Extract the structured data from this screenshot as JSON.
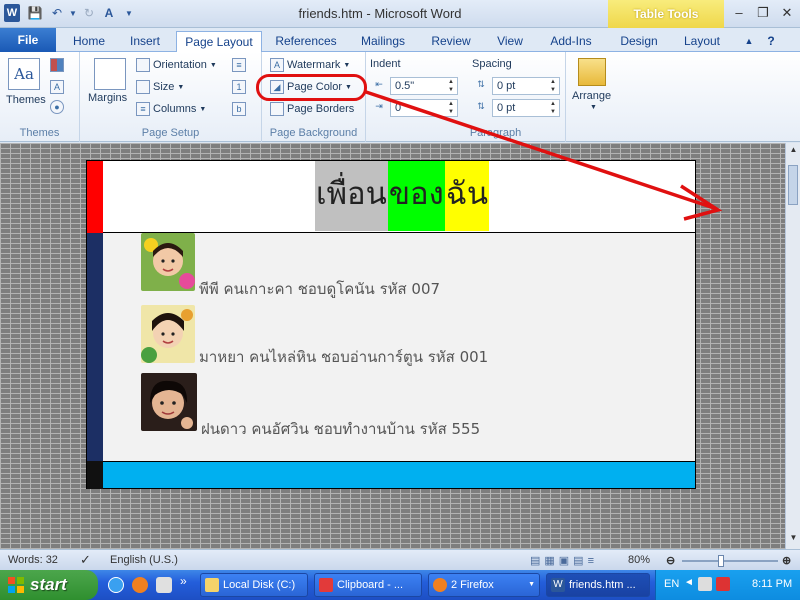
{
  "window": {
    "title": "friends.htm - Microsoft Word",
    "table_tools": "Table Tools"
  },
  "tabs": [
    "File",
    "Home",
    "Insert",
    "Page Layout",
    "References",
    "Mailings",
    "Review",
    "View",
    "Add-Ins",
    "Design",
    "Layout"
  ],
  "ribbon": {
    "themes": {
      "label": "Themes",
      "group": "Themes"
    },
    "page_setup": {
      "margins": "Margins",
      "orientation": "Orientation",
      "size": "Size",
      "columns": "Columns",
      "group": "Page Setup"
    },
    "page_background": {
      "watermark": "Watermark",
      "page_color": "Page Color",
      "page_borders": "Page Borders",
      "group": "Page Background"
    },
    "paragraph": {
      "indent": "Indent",
      "spacing": "Spacing",
      "indent_left": "0.5\"",
      "indent_right": "0",
      "spacing_before": "0 pt",
      "spacing_after": "0 pt",
      "group": "Paragraph"
    },
    "arrange": {
      "label": "Arrange"
    }
  },
  "document": {
    "header_segments": [
      {
        "text": "เพื่อน",
        "bg": "#c0c0c0"
      },
      {
        "text": "ของ",
        "bg": "#00ff00"
      },
      {
        "text": "ฉัน",
        "bg": "#ffff00"
      }
    ],
    "friends": [
      {
        "text": "พีพี คนเกาะคา ชอบดูโคนัน รหัส 007"
      },
      {
        "text": "มาหยา คนไหล่หิน ชอบอ่านการ์ตูน รหัส 001"
      },
      {
        "text": "ฝนดาว คนอัศวิน ชอบทำงานบ้าน รหัส 555"
      }
    ]
  },
  "statusbar": {
    "words": "Words: 32",
    "language": "English (U.S.)",
    "zoom": "80%"
  },
  "taskbar": {
    "start": "start",
    "tasks": [
      "Local Disk (C:)",
      "Clipboard - ...",
      "2 Firefox",
      "friends.htm ..."
    ],
    "lang": "EN",
    "clock": "8:11 PM"
  },
  "colors": {
    "highlight_red": "#e01010",
    "strip_red": "#ff0000",
    "strip_blue": "#1c2f64",
    "footer_blue": "#00b0f0"
  }
}
